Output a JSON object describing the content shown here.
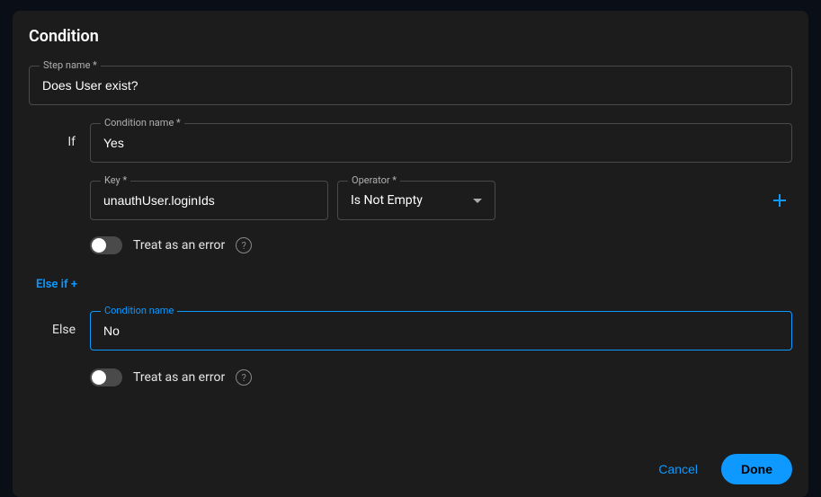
{
  "title": "Condition",
  "step_name": {
    "label": "Step name *",
    "value": "Does User exist?"
  },
  "if": {
    "section_label": "If",
    "condition_name": {
      "label": "Condition name *",
      "value": "Yes"
    },
    "key": {
      "label": "Key *",
      "value": "unauthUser.loginIds"
    },
    "operator": {
      "label": "Operator *",
      "value": "Is Not Empty"
    },
    "treat_as_error": {
      "label": "Treat as an error",
      "enabled": false
    }
  },
  "else_if_link": "Else if +",
  "else": {
    "section_label": "Else",
    "condition_name": {
      "label": "Condition name",
      "value": "No"
    },
    "treat_as_error": {
      "label": "Treat as an error",
      "enabled": false
    }
  },
  "footer": {
    "cancel": "Cancel",
    "done": "Done"
  }
}
